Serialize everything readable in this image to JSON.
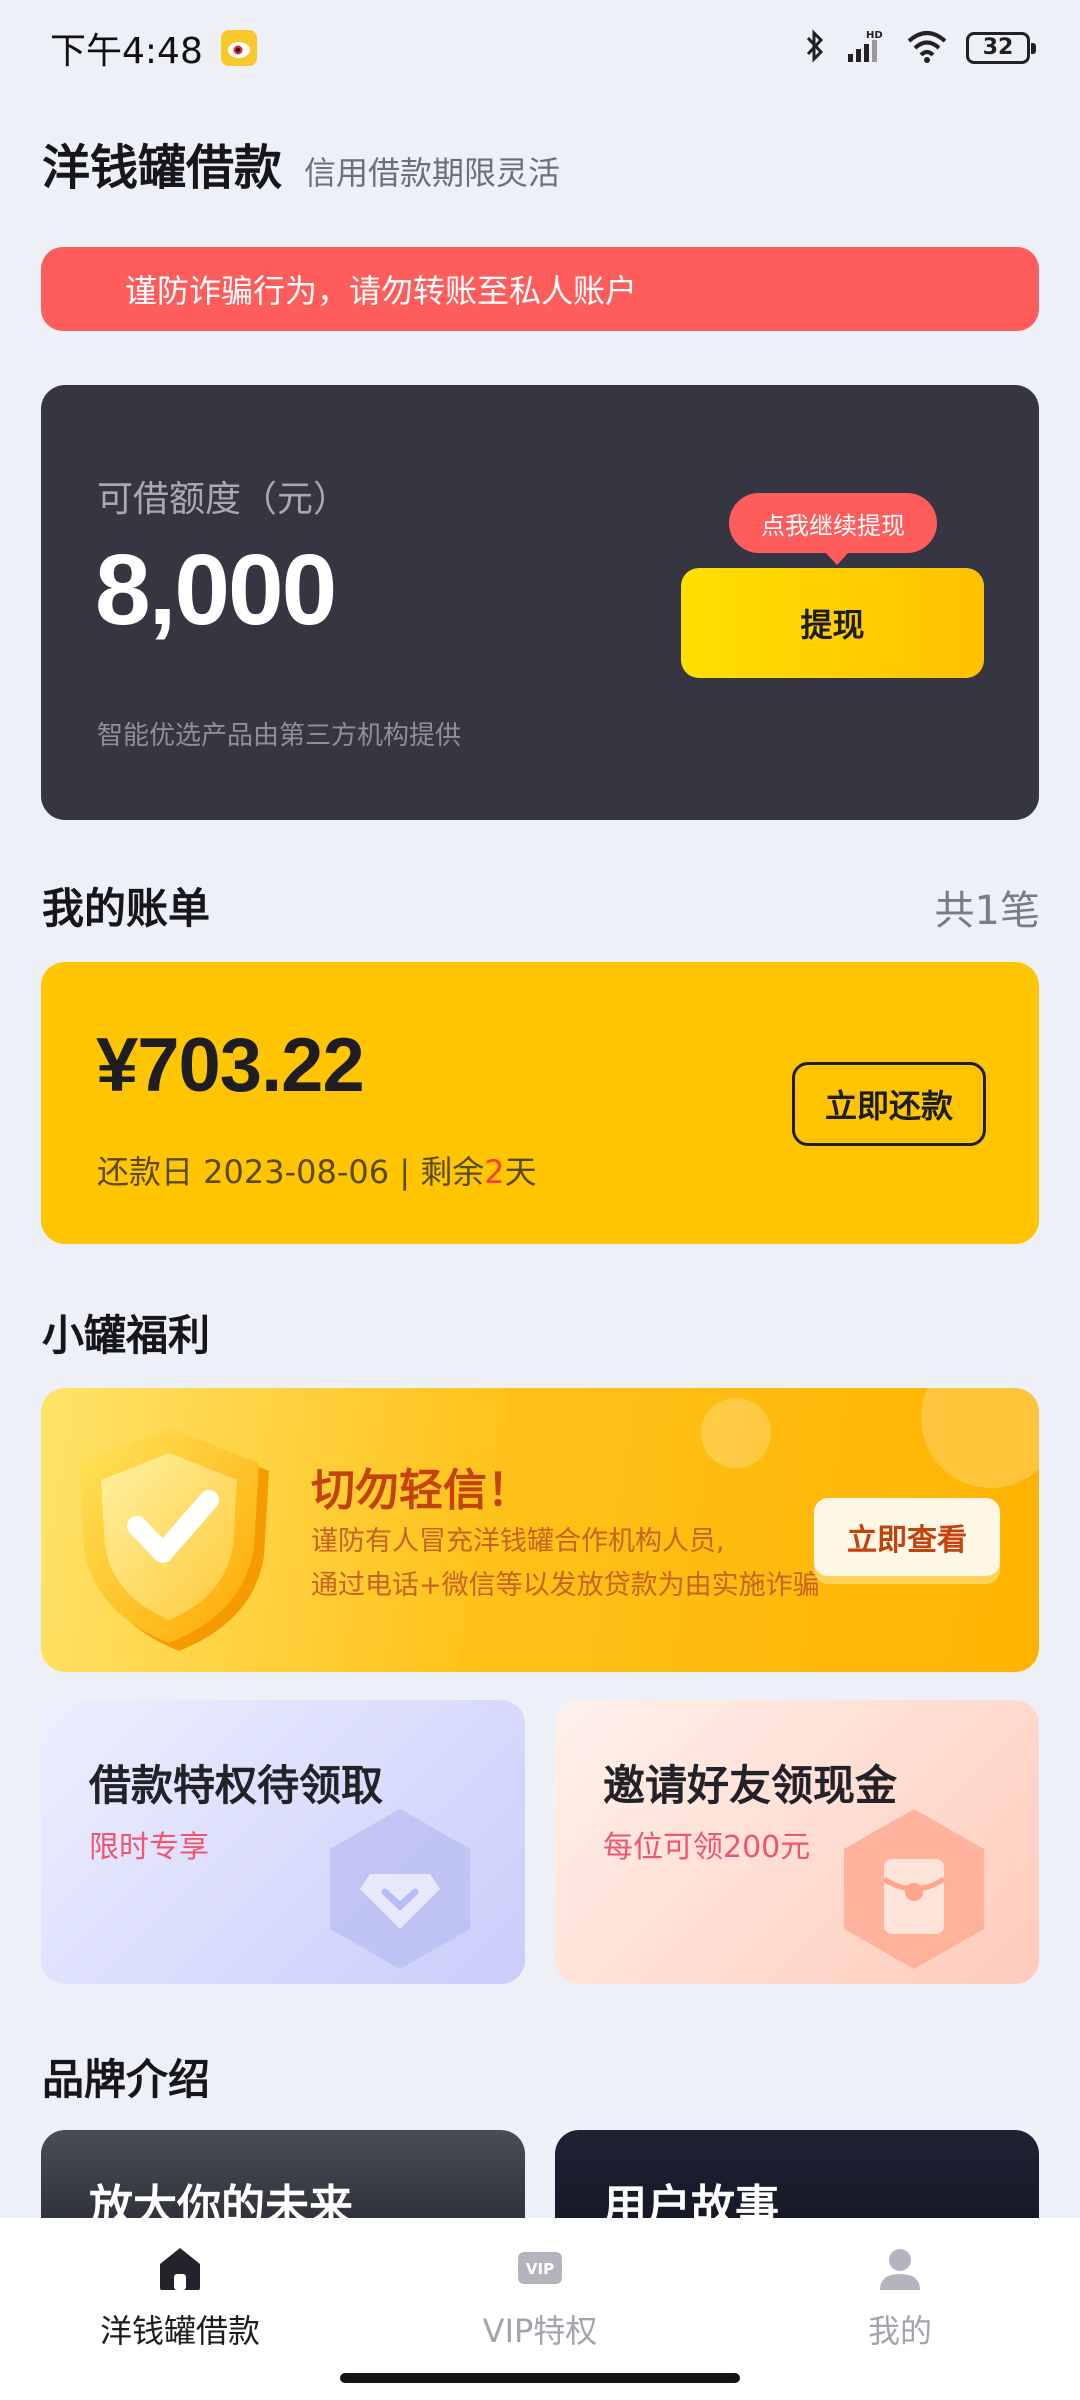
{
  "status_bar": {
    "time": "下午4:48",
    "battery": "32",
    "network": "HD"
  },
  "header": {
    "title": "洋钱罐借款",
    "subtitle": "信用借款期限灵活"
  },
  "warning": {
    "text": "谨防诈骗行为，请勿转账至私人账户"
  },
  "credit": {
    "label": "可借额度（元）",
    "amount": "8,000",
    "note": "智能优选产品由第三方机构提供",
    "tip": "点我继续提现",
    "withdraw_label": "提现"
  },
  "bills": {
    "title": "我的账单",
    "count": "共1笔",
    "amount": "¥703.22",
    "due_prefix": "还款日 2023-08-06 | 剩余",
    "days_left": "2",
    "due_suffix": "天",
    "repay_label": "立即还款"
  },
  "welfare": {
    "title": "小罐福利",
    "banner_title": "切勿轻信！",
    "banner_line1": "谨防有人冒充洋钱罐合作机构人员,",
    "banner_line2": "通过电话+微信等以发放贷款为由实施诈骗",
    "view_label": "立即查看"
  },
  "features": [
    {
      "title": "借款特权待领取",
      "subtitle": "限时专享"
    },
    {
      "title": "邀请好友领现金",
      "subtitle": "每位可领200元"
    }
  ],
  "brand": {
    "title": "品牌介绍",
    "cards": [
      {
        "title": "放大你的未来"
      },
      {
        "title": "用户故事"
      }
    ]
  },
  "nav": {
    "items": [
      {
        "label": "洋钱罐借款",
        "icon": "home-icon",
        "active": true
      },
      {
        "label": "VIP特权",
        "icon": "vip-icon",
        "active": false
      },
      {
        "label": "我的",
        "icon": "user-icon",
        "active": false
      }
    ]
  },
  "colors": {
    "background": "#EEF0F8",
    "warning": "#FF5C5C",
    "dark_card": "#363642",
    "accent_yellow": "#FFC500"
  }
}
